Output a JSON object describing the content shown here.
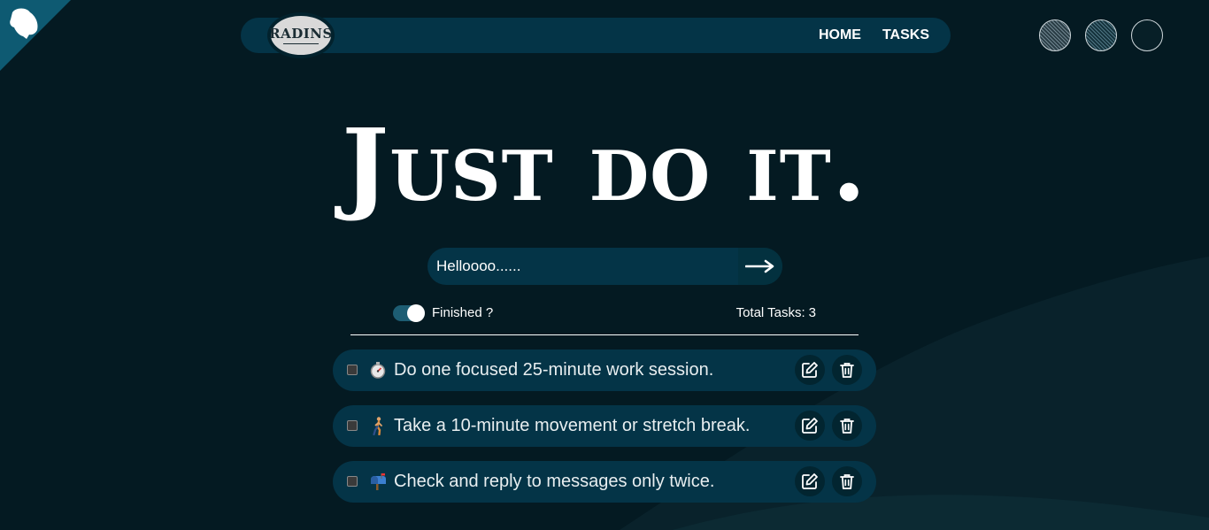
{
  "nav": {
    "logo": "RADINS",
    "links": [
      "HOME",
      "TASKS"
    ]
  },
  "themes": [
    "theme-1",
    "theme-2",
    "theme-3"
  ],
  "hero": {
    "title": "Just do it."
  },
  "form": {
    "input_value": "Helloooo......",
    "submit_icon": "arrow-right-icon"
  },
  "filter": {
    "label": "Finished ?",
    "toggle_on": true
  },
  "total": {
    "label": "Total Tasks:",
    "count": "3"
  },
  "tasks": [
    {
      "emoji": "stopwatch-icon",
      "text": "Do one focused 25-minute work session."
    },
    {
      "emoji": "walking-person-icon",
      "text": "Take a 10-minute movement or stretch break."
    },
    {
      "emoji": "mailbox-icon",
      "text": "Check and reply to messages only twice."
    }
  ],
  "colors": {
    "background": "#041a22",
    "surface": "#043447",
    "accent": "#1d5d73"
  }
}
